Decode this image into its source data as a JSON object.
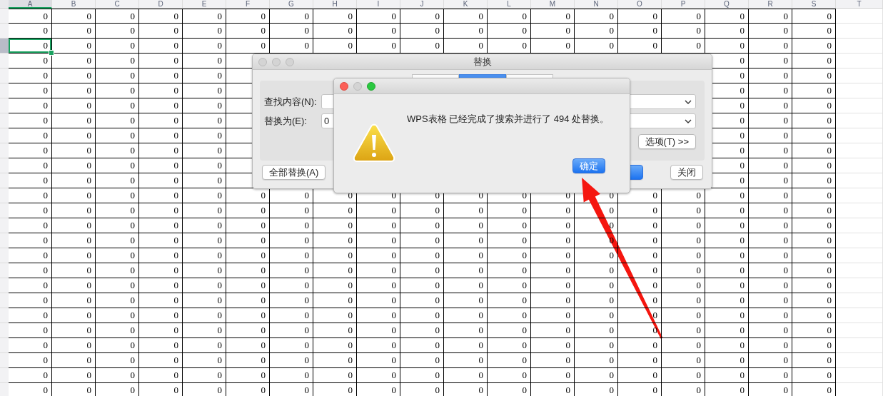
{
  "sheet": {
    "columns": [
      {
        "label": "A",
        "selected": true
      },
      {
        "label": "B",
        "selected": false
      },
      {
        "label": "C",
        "selected": false
      },
      {
        "label": "D",
        "selected": false
      },
      {
        "label": "E",
        "selected": false
      },
      {
        "label": "F",
        "selected": false
      },
      {
        "label": "G",
        "selected": false
      },
      {
        "label": "H",
        "selected": false
      },
      {
        "label": "I",
        "selected": false
      },
      {
        "label": "J",
        "selected": false
      },
      {
        "label": "K",
        "selected": false
      },
      {
        "label": "L",
        "selected": false
      },
      {
        "label": "M",
        "selected": false
      },
      {
        "label": "N",
        "selected": false
      },
      {
        "label": "O",
        "selected": false
      },
      {
        "label": "P",
        "selected": false
      },
      {
        "label": "Q",
        "selected": false
      },
      {
        "label": "R",
        "selected": false
      },
      {
        "label": "S",
        "selected": false
      },
      {
        "label": "T",
        "selected": false
      }
    ],
    "rows": [
      {
        "selected": false,
        "cells": [
          "0",
          "0",
          "0",
          "0",
          "0",
          "0",
          "0",
          "0",
          "0",
          "0",
          "0",
          "0",
          "0",
          "0",
          "0",
          "0",
          "0",
          "0",
          "0"
        ]
      },
      {
        "selected": false,
        "cells": [
          "0",
          "0",
          "0",
          "0",
          "0",
          "0",
          "0",
          "0",
          "0",
          "0",
          "0",
          "0",
          "0",
          "0",
          "0",
          "0",
          "0",
          "0",
          "0"
        ]
      },
      {
        "selected": true,
        "cells": [
          "0",
          "0",
          "0",
          "0",
          "0",
          "0",
          "0",
          "0",
          "0",
          "0",
          "0",
          "0",
          "0",
          "0",
          "0",
          "0",
          "0",
          "0",
          "0"
        ]
      },
      {
        "selected": false,
        "cells": [
          "0",
          "0",
          "0",
          "0",
          "0",
          null,
          null,
          null,
          null,
          null,
          null,
          null,
          null,
          null,
          null,
          null,
          "0",
          "0",
          "0"
        ]
      },
      {
        "selected": false,
        "cells": [
          "0",
          "0",
          "0",
          "0",
          "0",
          null,
          null,
          null,
          null,
          null,
          null,
          null,
          null,
          null,
          null,
          null,
          "0",
          "0",
          "0"
        ]
      },
      {
        "selected": false,
        "cells": [
          "0",
          "0",
          "0",
          "0",
          "0",
          null,
          null,
          null,
          null,
          null,
          null,
          null,
          null,
          null,
          null,
          null,
          "0",
          "0",
          "0"
        ]
      },
      {
        "selected": false,
        "cells": [
          "0",
          "0",
          "0",
          "0",
          "0",
          null,
          null,
          null,
          null,
          null,
          null,
          null,
          null,
          null,
          null,
          null,
          "0",
          "0",
          "0"
        ]
      },
      {
        "selected": false,
        "cells": [
          "0",
          "0",
          "0",
          "0",
          "0",
          null,
          null,
          null,
          null,
          null,
          null,
          null,
          null,
          null,
          null,
          null,
          "0",
          "0",
          "0"
        ]
      },
      {
        "selected": false,
        "cells": [
          "0",
          "0",
          "0",
          "0",
          "0",
          null,
          null,
          null,
          null,
          null,
          null,
          null,
          null,
          null,
          null,
          null,
          "0",
          "0",
          "0"
        ]
      },
      {
        "selected": false,
        "cells": [
          "0",
          "0",
          "0",
          "0",
          "0",
          null,
          null,
          null,
          null,
          null,
          null,
          null,
          null,
          null,
          null,
          null,
          "0",
          "0",
          "0"
        ]
      },
      {
        "selected": false,
        "cells": [
          "0",
          "0",
          "0",
          "0",
          "0",
          null,
          null,
          null,
          null,
          null,
          null,
          null,
          null,
          null,
          null,
          null,
          "0",
          "0",
          "0"
        ]
      },
      {
        "selected": false,
        "cells": [
          "0",
          "0",
          "0",
          "0",
          "0",
          null,
          null,
          null,
          null,
          null,
          null,
          null,
          null,
          null,
          null,
          null,
          "0",
          "0",
          "0"
        ]
      },
      {
        "selected": false,
        "cells": [
          "0",
          "0",
          "0",
          "0",
          "0",
          "0",
          "0",
          "0",
          "0",
          "0",
          "0",
          "0",
          "0",
          "0",
          "0",
          "0",
          "0",
          "0",
          "0"
        ]
      },
      {
        "selected": false,
        "cells": [
          "0",
          "0",
          "0",
          "0",
          "0",
          "0",
          "0",
          "0",
          "0",
          "0",
          "0",
          "0",
          "0",
          "0",
          "0",
          "0",
          "0",
          "0",
          "0"
        ]
      },
      {
        "selected": false,
        "cells": [
          "0",
          "0",
          "0",
          "0",
          "0",
          "0",
          "0",
          "0",
          "0",
          "0",
          "0",
          "0",
          "0",
          "0",
          "0",
          "0",
          "0",
          "0",
          "0"
        ]
      },
      {
        "selected": false,
        "cells": [
          "0",
          "0",
          "0",
          "0",
          "0",
          "0",
          "0",
          "0",
          "0",
          "0",
          "0",
          "0",
          "0",
          "0",
          "0",
          "0",
          "0",
          "0",
          "0"
        ]
      },
      {
        "selected": false,
        "cells": [
          "0",
          "0",
          "0",
          "0",
          "0",
          "0",
          "0",
          "0",
          "0",
          "0",
          "0",
          "0",
          "0",
          "0",
          "0",
          "0",
          "0",
          "0",
          "0"
        ]
      },
      {
        "selected": false,
        "cells": [
          "0",
          "0",
          "0",
          "0",
          "0",
          "0",
          "0",
          "0",
          "0",
          "0",
          "0",
          "0",
          "0",
          "0",
          "0",
          "0",
          "0",
          "0",
          "0"
        ]
      },
      {
        "selected": false,
        "cells": [
          "0",
          "0",
          "0",
          "0",
          "0",
          "0",
          "0",
          "0",
          "0",
          "0",
          "0",
          "0",
          "0",
          "0",
          "0",
          "0",
          "0",
          "0",
          "0"
        ]
      },
      {
        "selected": false,
        "cells": [
          "0",
          "0",
          "0",
          "0",
          "0",
          "0",
          "0",
          "0",
          "0",
          "0",
          "0",
          "0",
          "0",
          "0",
          "0",
          "0",
          "0",
          "0",
          "0"
        ]
      },
      {
        "selected": false,
        "cells": [
          "0",
          "0",
          "0",
          "0",
          "0",
          "0",
          "0",
          "0",
          "0",
          "0",
          "0",
          "0",
          "0",
          "0",
          "0",
          "0",
          "0",
          "0",
          "0"
        ]
      },
      {
        "selected": false,
        "cells": [
          "0",
          "0",
          "0",
          "0",
          "0",
          "0",
          "0",
          "0",
          "0",
          "0",
          "0",
          "0",
          "0",
          "0",
          "0",
          "0",
          "0",
          "0",
          "0"
        ]
      },
      {
        "selected": false,
        "cells": [
          "0",
          "0",
          "0",
          "0",
          "0",
          "0",
          "0",
          "0",
          "0",
          "0",
          "0",
          "0",
          "0",
          "0",
          "0",
          "0",
          "0",
          "0",
          "0"
        ]
      },
      {
        "selected": false,
        "cells": [
          "0",
          "0",
          "0",
          "0",
          "0",
          "0",
          "0",
          "0",
          "0",
          "0",
          "0",
          "0",
          "0",
          "0",
          "0",
          "0",
          "0",
          "0",
          "0"
        ]
      },
      {
        "selected": false,
        "cells": [
          "0",
          "0",
          "0",
          "0",
          "0",
          "0",
          "0",
          "0",
          "0",
          "0",
          "0",
          "0",
          "0",
          "0",
          "0",
          "0",
          "0",
          "0",
          "0"
        ]
      },
      {
        "selected": false,
        "cells": [
          "0",
          "0",
          "0",
          "0",
          "0",
          "0",
          "0",
          "0",
          "0",
          "0",
          "0",
          "0",
          "0",
          "0",
          "0",
          "0",
          "0",
          "0",
          "0"
        ]
      }
    ]
  },
  "replace_dialog": {
    "title": "替换",
    "tabs": [
      {
        "selected": false
      },
      {
        "selected": true
      },
      {
        "selected": false
      }
    ],
    "find_label": "查找内容(N):",
    "replace_label": "替换为(E):",
    "replace_value": "0",
    "options_button": "选项(T) >>",
    "replace_all_button": "全部替换(A)",
    "close_button": "关闭"
  },
  "alert": {
    "message": "WPS表格 已经完成了搜索并进行了 494 处替换。",
    "ok_button": "确定"
  }
}
